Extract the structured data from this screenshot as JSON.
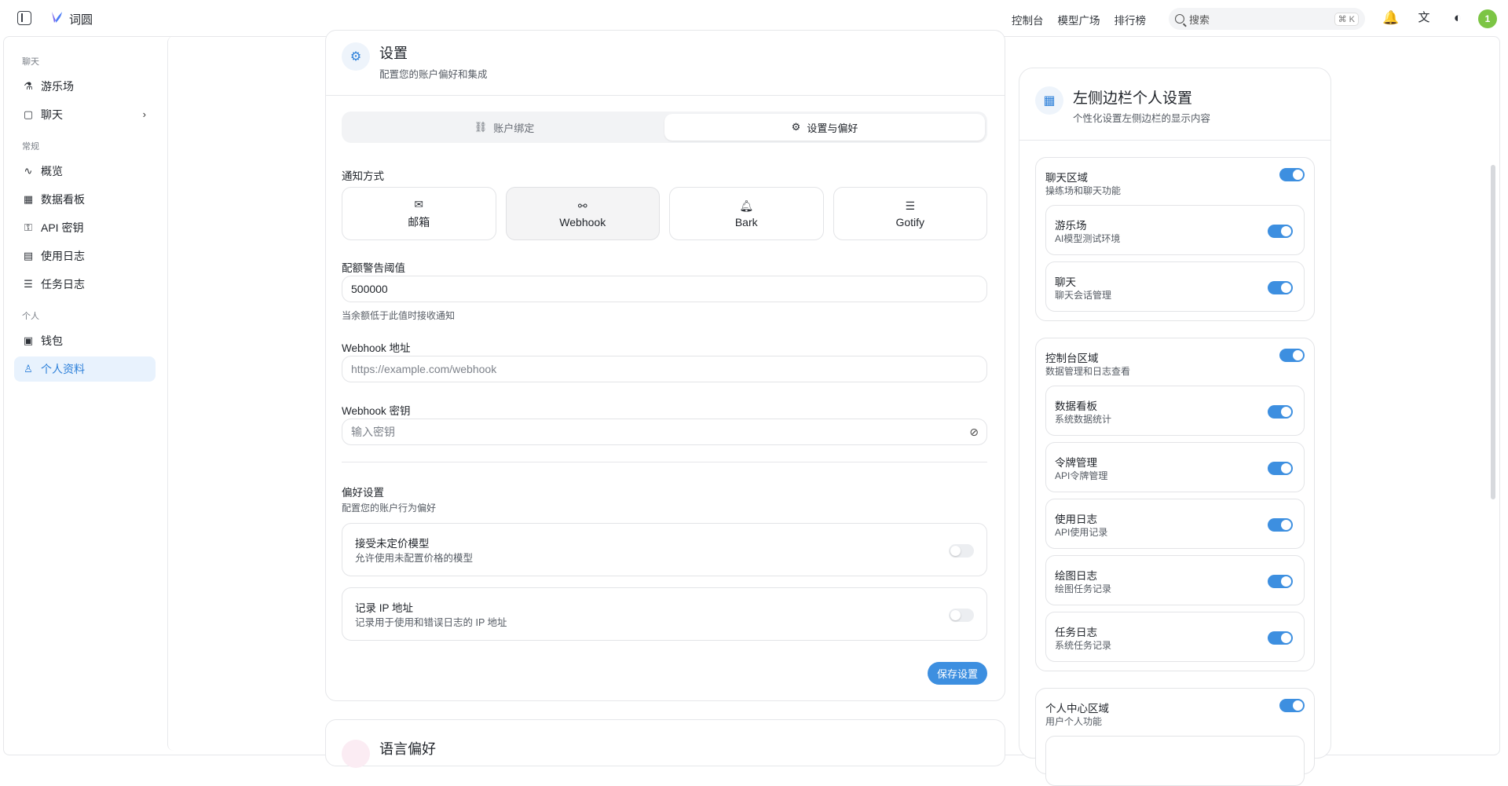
{
  "app": {
    "title": "词圆"
  },
  "topnav": {
    "links": [
      "控制台",
      "模型广场",
      "排行榜"
    ],
    "search_placeholder": "搜索",
    "shortcut": "⌘ K",
    "avatar_text": "1"
  },
  "sidebar": {
    "groups": [
      {
        "label": "聊天",
        "items": [
          {
            "label": "游乐场",
            "icon": "flask-icon"
          },
          {
            "label": "聊天",
            "icon": "message-icon"
          }
        ]
      },
      {
        "label": "常规",
        "items": [
          {
            "label": "概览",
            "icon": "activity-icon"
          },
          {
            "label": "数据看板",
            "icon": "grid-icon"
          },
          {
            "label": "API 密钥",
            "icon": "key-icon"
          },
          {
            "label": "使用日志",
            "icon": "file-icon"
          },
          {
            "label": "任务日志",
            "icon": "list-icon"
          }
        ]
      },
      {
        "label": "个人",
        "items": [
          {
            "label": "钱包",
            "icon": "wallet-icon"
          },
          {
            "label": "个人资料",
            "icon": "user-icon"
          }
        ]
      }
    ]
  },
  "settings": {
    "title": "设置",
    "subtitle": "配置您的账户偏好和集成",
    "tabs": [
      {
        "label": "账户绑定",
        "icon": "link-icon"
      },
      {
        "label": "设置与偏好",
        "icon": "gear-icon"
      }
    ],
    "notify_label": "通知方式",
    "notify_options": [
      {
        "label": "邮箱",
        "icon": "mail-icon"
      },
      {
        "label": "Webhook",
        "icon": "webhook-icon"
      },
      {
        "label": "Bark",
        "icon": "bell-icon"
      },
      {
        "label": "Gotify",
        "icon": "server-icon"
      }
    ],
    "quota_label": "配额警告阈值",
    "quota_value": "500000",
    "quota_hint": "当余额低于此值时接收通知",
    "webhook_url_label": "Webhook 地址",
    "webhook_url_placeholder": "https://example.com/webhook",
    "webhook_secret_label": "Webhook 密钥",
    "webhook_secret_placeholder": "输入密钥",
    "pref_title": "偏好设置",
    "pref_subtitle": "配置您的账户行为偏好",
    "prefs": [
      {
        "title": "接受未定价模型",
        "desc": "允许使用未配置价格的模型"
      },
      {
        "title": "记录 IP 地址",
        "desc": "记录用于使用和错误日志的 IP 地址"
      }
    ],
    "save_label": "保存设置",
    "next_section_title": "语言偏好"
  },
  "right_panel": {
    "title": "左侧边栏个人设置",
    "subtitle": "个性化设置左侧边栏的显示内容",
    "sections": [
      {
        "title": "聊天区域",
        "desc": "操练场和聊天功能",
        "items": [
          {
            "title": "游乐场",
            "desc": "AI模型测试环境"
          },
          {
            "title": "聊天",
            "desc": "聊天会话管理"
          }
        ]
      },
      {
        "title": "控制台区域",
        "desc": "数据管理和日志查看",
        "items": [
          {
            "title": "数据看板",
            "desc": "系统数据统计"
          },
          {
            "title": "令牌管理",
            "desc": "API令牌管理"
          },
          {
            "title": "使用日志",
            "desc": "API使用记录"
          },
          {
            "title": "绘图日志",
            "desc": "绘图任务记录"
          },
          {
            "title": "任务日志",
            "desc": "系统任务记录"
          }
        ]
      },
      {
        "title": "个人中心区域",
        "desc": "用户个人功能",
        "items": []
      }
    ]
  },
  "colors": {
    "accent": "#3d8fe0",
    "active_bg": "#e8f2fd",
    "avatar": "#7cc544"
  }
}
